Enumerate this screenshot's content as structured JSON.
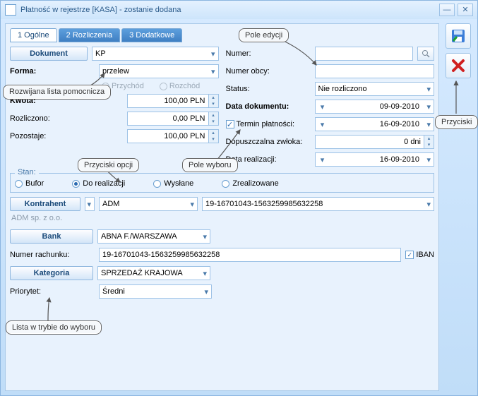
{
  "window": {
    "title": "Płatność w rejestrze [KASA] - zostanie dodana"
  },
  "tabs": {
    "t1": "1 Ogólne",
    "t2": "2 Rozliczenia",
    "t3": "3 Dodatkowe"
  },
  "left": {
    "dokument_btn": "Dokument",
    "dokument_val": "KP",
    "forma_lbl": "Forma:",
    "forma_val": "przelew",
    "przychod": "Przychód",
    "rozchod": "Rozchód",
    "kwota_lbl": "Kwota:",
    "kwota_val": "100,00 PLN",
    "rozliczono_lbl": "Rozliczono:",
    "rozliczono_val": "0,00 PLN",
    "pozostaje_lbl": "Pozostaje:",
    "pozostaje_val": "100,00 PLN"
  },
  "right": {
    "numer_lbl": "Numer:",
    "numer_val": "",
    "numerobcy_lbl": "Numer obcy:",
    "numerobcy_val": "",
    "status_lbl": "Status:",
    "status_val": "Nie rozliczono",
    "datadok_lbl": "Data dokumentu:",
    "datadok_val": "09-09-2010",
    "termin_lbl": "Termin płatności:",
    "termin_val": "16-09-2010",
    "zwloka_lbl": "Dopuszczalna zwłoka:",
    "zwloka_val": "0 dni",
    "realiz_lbl": "Data realizacji:",
    "realiz_val": "16-09-2010"
  },
  "stan": {
    "title": "Stan:",
    "bufor": "Bufor",
    "doreal": "Do realizacji",
    "wyslane": "Wysłane",
    "zreal": "Zrealizowane"
  },
  "kontrahent": {
    "btn": "Kontrahent",
    "name": "ADM",
    "acct_top": "19-16701043-1563259985632258",
    "dimmed": "ADM sp. z o.o."
  },
  "bank": {
    "btn": "Bank",
    "val": "ABNA F./WARSZAWA",
    "rach_lbl": "Numer rachunku:",
    "rach_val": "19-16701043-1563259985632258",
    "iban": "IBAN"
  },
  "kategoria": {
    "btn": "Kategoria",
    "val": "SPRZEDAŻ KRAJOWA",
    "prio_lbl": "Priorytet:",
    "prio_val": "Średni"
  },
  "callouts": {
    "c1": "Pole edycji",
    "c2": "Rozwijana lista pomocnicza",
    "c3": "Przyciski opcji",
    "c4": "Pole wyboru",
    "c5": "Lista w trybie do wyboru",
    "c6": "Przyciski"
  }
}
